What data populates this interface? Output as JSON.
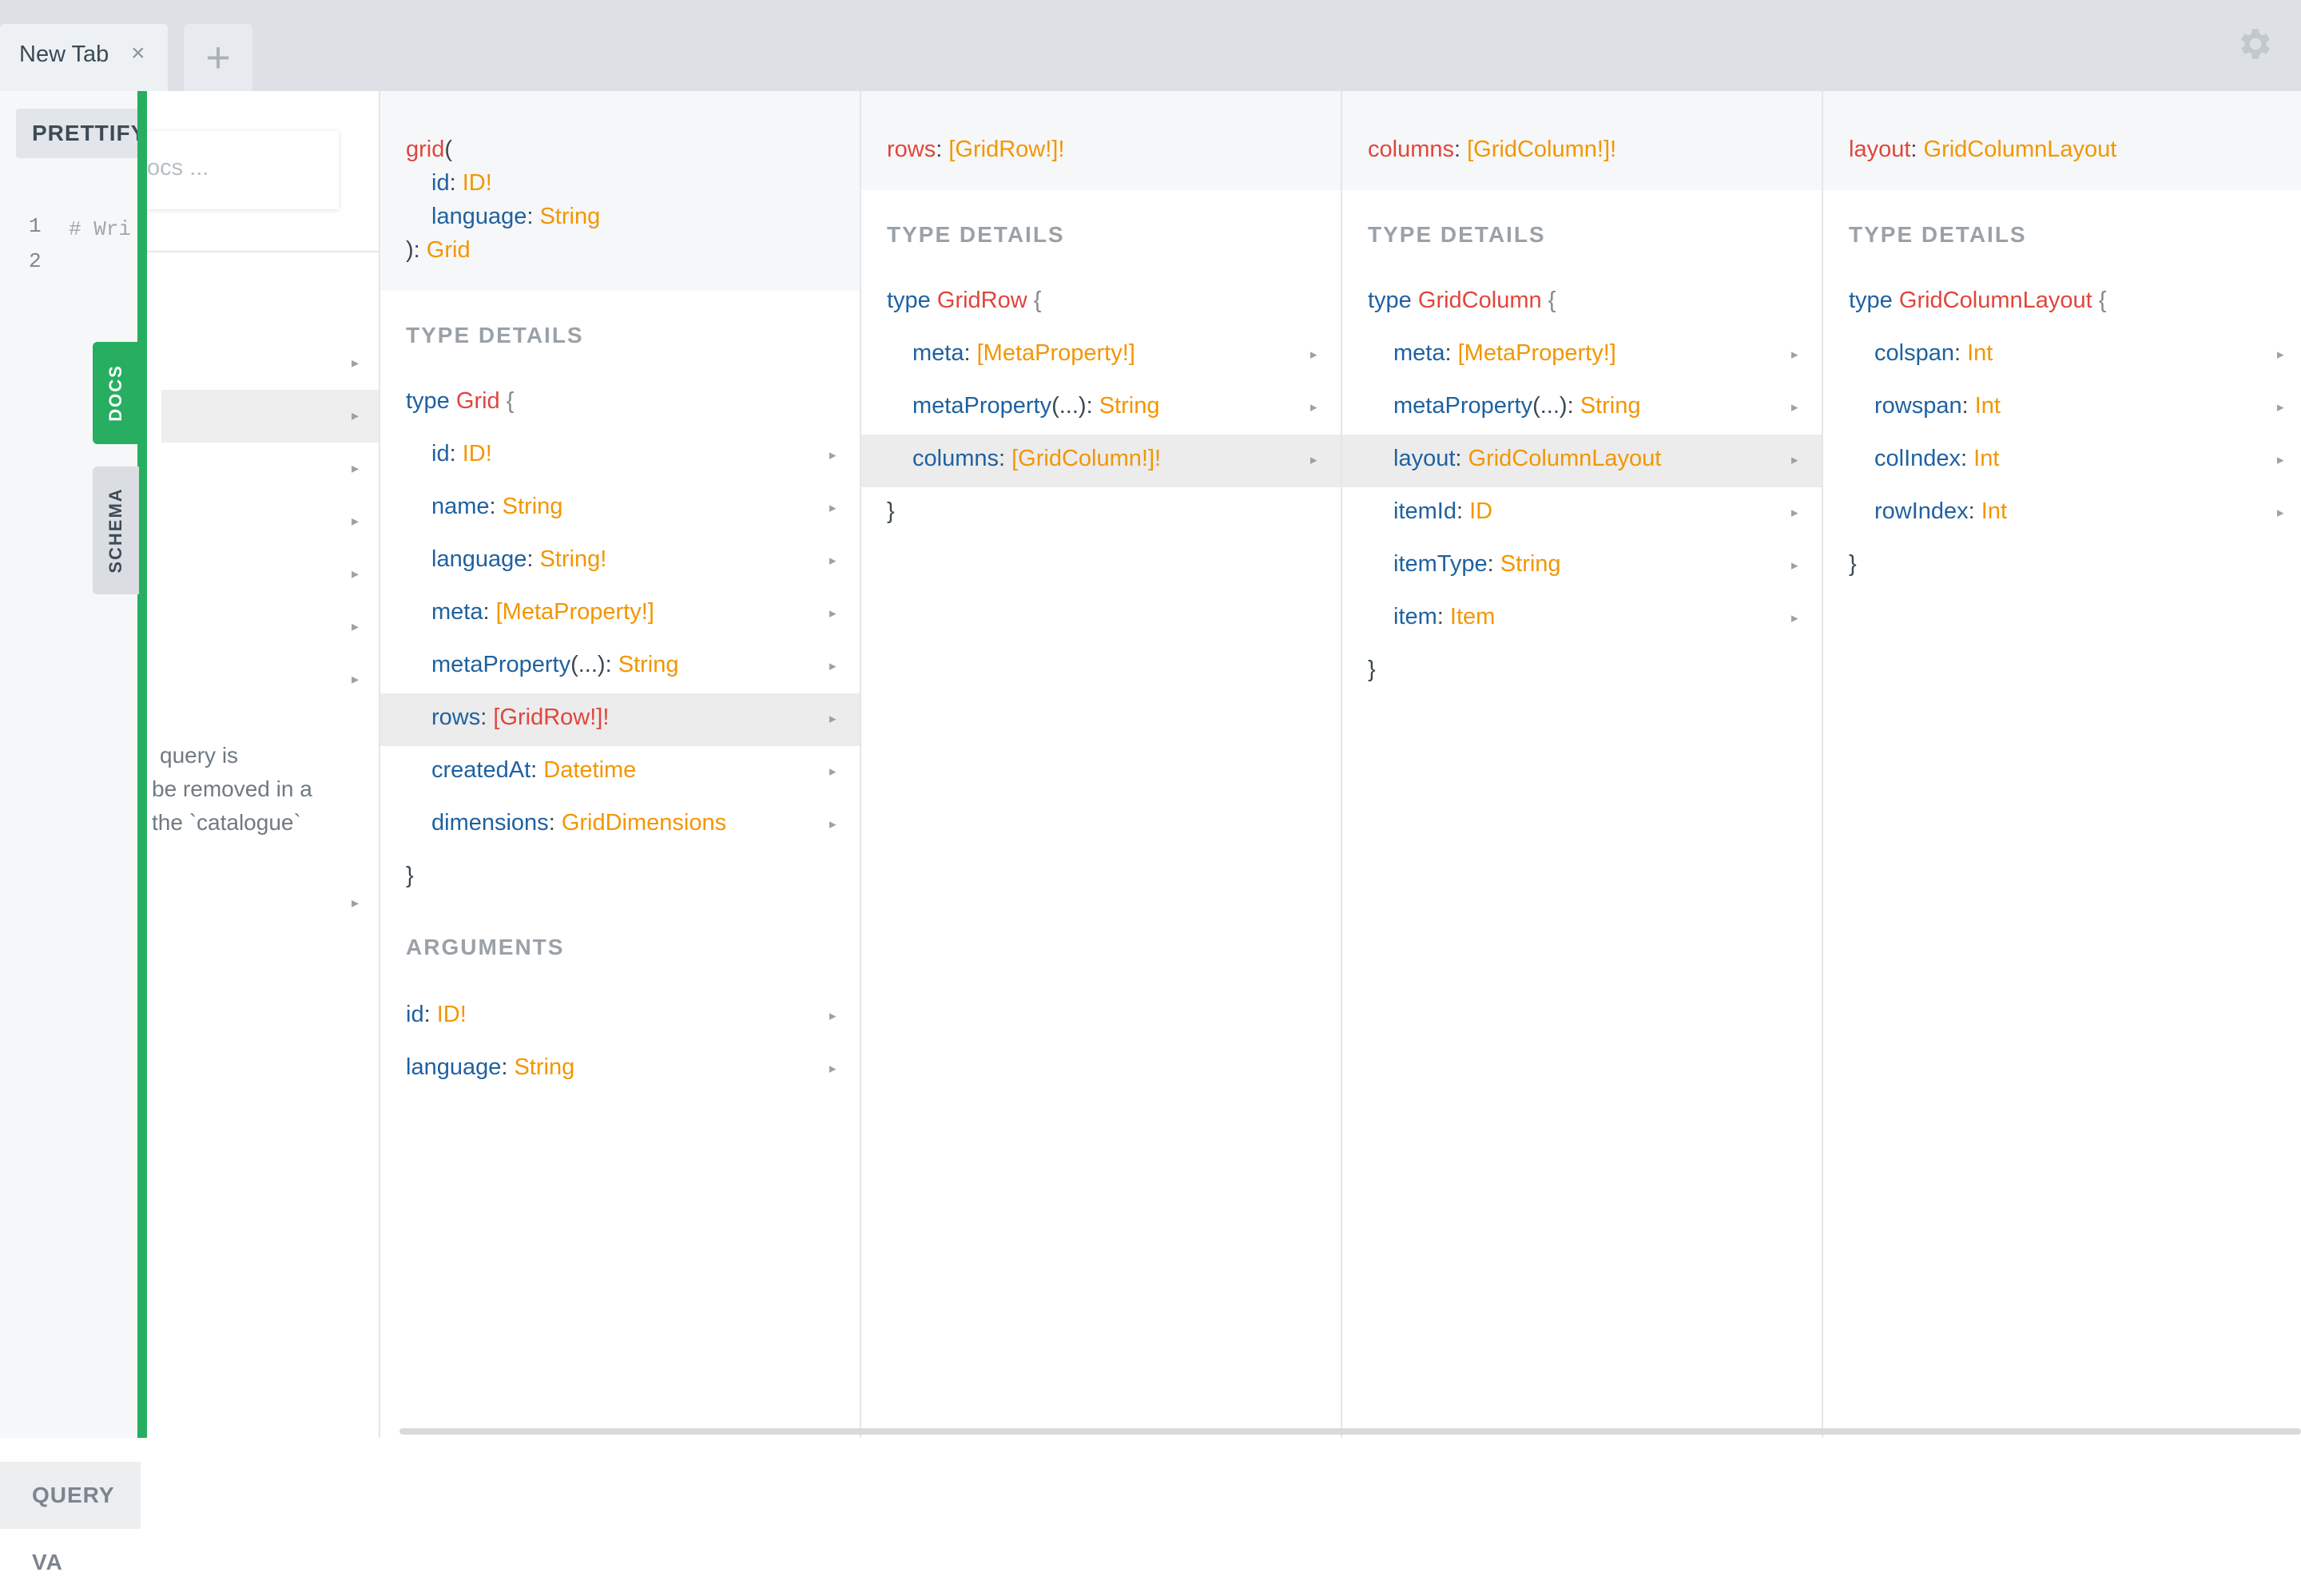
{
  "tabs": {
    "active_label": "New Tab",
    "close_glyph": "×",
    "add_glyph": "+"
  },
  "editor": {
    "prettify_label": "PRETTIFY",
    "line_numbers": [
      "1",
      "2"
    ],
    "code_line_1": "# Wri",
    "query_vars_label": "QUERY VA"
  },
  "side_tabs": {
    "docs": "DOCS",
    "schema": "SCHEMA"
  },
  "col0": {
    "search_placeholder": "ocs ...",
    "desc_lines": [
      "query is",
      "be removed in a",
      "the `catalogue`"
    ]
  },
  "col1": {
    "field_name": "grid",
    "open_paren": "(",
    "args_sig": [
      {
        "name": "id",
        "type": "ID!"
      },
      {
        "name": "language",
        "type": "String"
      }
    ],
    "close": "): ",
    "return_type": "Grid",
    "type_details_label": "TYPE DETAILS",
    "type_keyword": "type",
    "type_name": "Grid",
    "fields": [
      {
        "name": "id",
        "type": "ID!"
      },
      {
        "name": "name",
        "type": "String"
      },
      {
        "name": "language",
        "type": "String!"
      },
      {
        "name": "meta",
        "type": "[MetaProperty!]"
      },
      {
        "name": "metaProperty",
        "args": "(...)",
        "type": "String"
      },
      {
        "name": "rows",
        "type": "[GridRow!]!"
      },
      {
        "name": "createdAt",
        "type": "Datetime"
      },
      {
        "name": "dimensions",
        "type": "GridDimensions"
      }
    ],
    "arguments_label": "ARGUMENTS",
    "arguments": [
      {
        "name": "id",
        "type": "ID!"
      },
      {
        "name": "language",
        "type": "String"
      }
    ]
  },
  "col2": {
    "field_name": "rows",
    "type": "[GridRow!]!",
    "type_details_label": "TYPE DETAILS",
    "type_keyword": "type",
    "type_name": "GridRow",
    "fields": [
      {
        "name": "meta",
        "type": "[MetaProperty!]"
      },
      {
        "name": "metaProperty",
        "args": "(...)",
        "type": "String"
      },
      {
        "name": "columns",
        "type": "[GridColumn!]!"
      }
    ]
  },
  "col3": {
    "field_name": "columns",
    "type": "[GridColumn!]!",
    "type_details_label": "TYPE DETAILS",
    "type_keyword": "type",
    "type_name": "GridColumn",
    "fields": [
      {
        "name": "meta",
        "type": "[MetaProperty!]"
      },
      {
        "name": "metaProperty",
        "args": "(...)",
        "type": "String"
      },
      {
        "name": "layout",
        "type": "GridColumnLayout"
      },
      {
        "name": "itemId",
        "type": "ID"
      },
      {
        "name": "itemType",
        "type": "String"
      },
      {
        "name": "item",
        "type": "Item"
      }
    ]
  },
  "col4": {
    "field_name": "layout",
    "type": "GridColumnLayout",
    "type_details_label": "TYPE DETAILS",
    "type_keyword": "type",
    "type_name": "GridColumnLayout",
    "fields": [
      {
        "name": "colspan",
        "type": "Int"
      },
      {
        "name": "rowspan",
        "type": "Int"
      },
      {
        "name": "colIndex",
        "type": "Int"
      },
      {
        "name": "rowIndex",
        "type": "Int"
      }
    ]
  },
  "punct": {
    "open_brace": "{",
    "close_brace": "}",
    "colon": ": "
  },
  "icons": {
    "field_arrow": "▸",
    "gear": "gear-icon"
  },
  "colors": {
    "field_name": "#e0463c",
    "arg_name": "#1f61a0",
    "type_name": "#f29602",
    "docs_green": "#27ae60"
  }
}
